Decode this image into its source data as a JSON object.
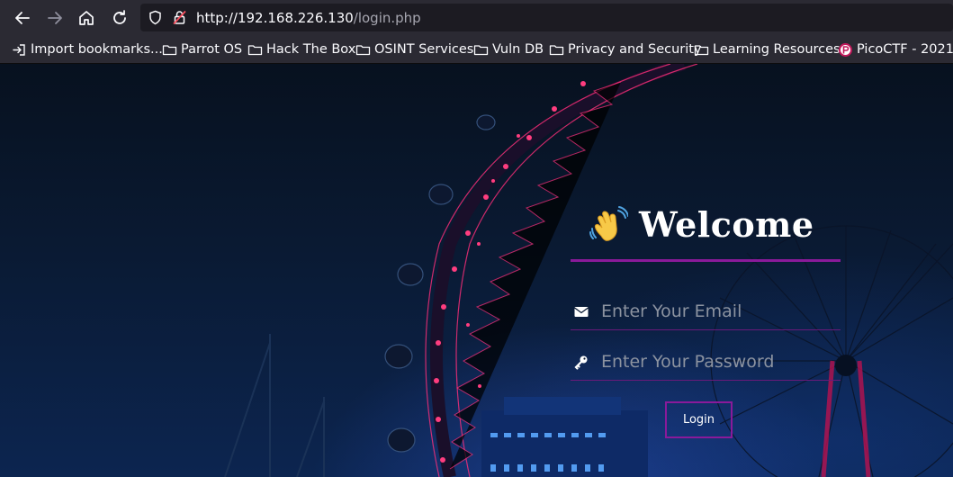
{
  "browser": {
    "nav": {
      "back_icon": "arrow-left-icon",
      "forward_icon": "arrow-right-icon",
      "home_icon": "home-icon",
      "reload_icon": "reload-icon"
    },
    "url": {
      "host": "http://192.168.226.130",
      "path": "/login.php",
      "shield_icon": "shield-icon",
      "insecure_icon": "insecure-lock-icon"
    },
    "bookmarks": [
      {
        "label": "Import bookmarks...",
        "icon": "import-icon"
      },
      {
        "label": "Parrot OS",
        "icon": "folder-icon"
      },
      {
        "label": "Hack The Box",
        "icon": "folder-icon"
      },
      {
        "label": "OSINT Services",
        "icon": "folder-icon"
      },
      {
        "label": "Vuln DB",
        "icon": "folder-icon"
      },
      {
        "label": "Privacy and Security",
        "icon": "folder-icon"
      },
      {
        "label": "Learning Resources",
        "icon": "folder-icon"
      },
      {
        "label": "PicoCTF - 2021",
        "icon": "picoctf-favicon"
      }
    ]
  },
  "login": {
    "title": "Welcome",
    "title_icon": "waving-hand-icon",
    "email": {
      "placeholder": "Enter Your Email",
      "value": "",
      "icon": "envelope-icon"
    },
    "password": {
      "placeholder": "Enter Your Password",
      "value": "",
      "icon": "key-icon"
    },
    "button_label": "Login"
  },
  "colors": {
    "accent": "#8a1a9a",
    "wheel_lights": "#ff2e7a",
    "background": "#0a1a33"
  }
}
